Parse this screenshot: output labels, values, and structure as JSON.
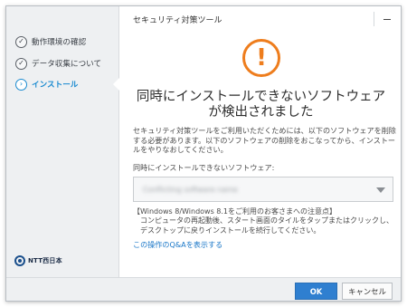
{
  "window": {
    "title": "セキュリティ対策ツール"
  },
  "sidebar": {
    "steps": [
      {
        "label": "動作環境の確認",
        "state": "done",
        "marker": "✓"
      },
      {
        "label": "データ収集について",
        "state": "done",
        "marker": "✓"
      },
      {
        "label": "インストール",
        "state": "active",
        "marker": "›"
      }
    ],
    "brand": "NTT西日本"
  },
  "main": {
    "warning_symbol": "!",
    "headline_line1": "同時にインストールできないソフトウェア",
    "headline_line2": "が検出されました",
    "description": "セキュリティ対策ツールをご利用いただくためには、以下のソフトウェアを削除する必要があります。以下のソフトウェアの削除をおこなってから、インストールをやりなおしてください。",
    "list_label": "同時にインストールできないソフトウェア:",
    "select_value": "Conflicting software name",
    "notice_title": "【Windows 8/Windows 8.1をご利用のお客さまへの注意点】",
    "notice_body": "コンピュータの再起動後、スタート画面のタイルをタップまたはクリックし、デスクトップに戻りインストールを続行してください。",
    "link_text": "この操作のQ&Aを表示する"
  },
  "footer": {
    "ok_label": "OK",
    "cancel_label": "キャンセル"
  },
  "colors": {
    "accent": "#1b8bd0",
    "warning": "#ee7d1d",
    "primary_button": "#2f7fd0",
    "link": "#1876c7"
  }
}
